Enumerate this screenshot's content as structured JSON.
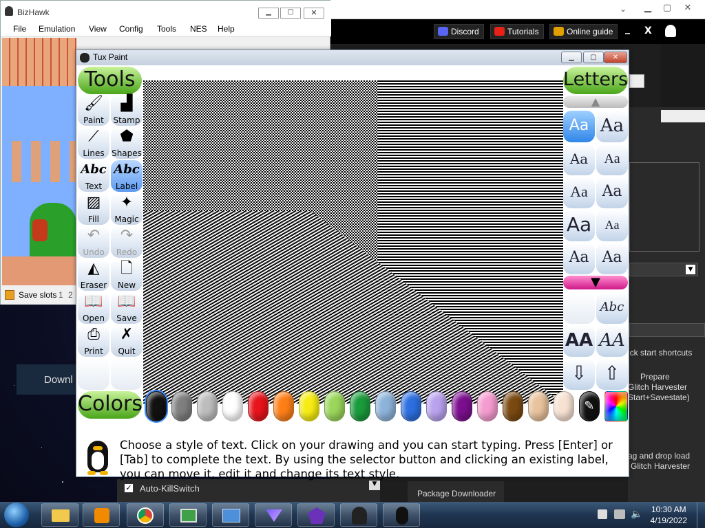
{
  "bizhawk": {
    "title": "BizHawk",
    "menu": [
      "File",
      "Emulation",
      "View",
      "Config",
      "Tools",
      "NES",
      "Help"
    ],
    "status_label": "Save slots",
    "slot_1": "1",
    "slot_2": "2"
  },
  "background_app": {
    "nav": {
      "discord": "Discord",
      "tutorials": "Tutorials",
      "online_guide": "Online guide",
      "minimize": "_",
      "close": "X"
    },
    "download_text": "Downl",
    "shortcuts_text": "ick start shortcuts",
    "prepare_text": "Prepare",
    "glitch_harvester_1": "Glitch Harvester",
    "savestate_text": "Start+Savestate)",
    "drag_drop_text": "ag and drop load",
    "glitch_harvester_2": "Glitch Harvester",
    "auto_killswitch": "Auto-KillSwitch",
    "package_downloader": "Package Downloader"
  },
  "tuxpaint": {
    "title": "Tux Paint",
    "tools_header": "Tools",
    "letters_header": "Letters",
    "colors_header": "Colors",
    "tools": [
      {
        "label": "Paint",
        "icon": "paintbrush-icon",
        "glyph": "🖌"
      },
      {
        "label": "Stamp",
        "icon": "stamp-icon",
        "glyph": "▟"
      },
      {
        "label": "Lines",
        "icon": "lines-icon",
        "glyph": "⟋"
      },
      {
        "label": "Shapes",
        "icon": "pentagon-icon",
        "glyph": "⬟"
      },
      {
        "label": "Text",
        "icon": "text-icon",
        "glyph": "Abc"
      },
      {
        "label": "Label",
        "icon": "label-icon",
        "glyph": "Abc"
      },
      {
        "label": "Fill",
        "icon": "bucket-icon",
        "glyph": "▨"
      },
      {
        "label": "Magic",
        "icon": "magic-wand-icon",
        "glyph": "✦"
      },
      {
        "label": "Undo",
        "icon": "undo-icon",
        "glyph": "↶"
      },
      {
        "label": "Redo",
        "icon": "redo-icon",
        "glyph": "↷"
      },
      {
        "label": "Eraser",
        "icon": "eraser-icon",
        "glyph": "◭"
      },
      {
        "label": "New",
        "icon": "new-page-icon",
        "glyph": "🗋"
      },
      {
        "label": "Open",
        "icon": "open-book-icon",
        "glyph": "📖"
      },
      {
        "label": "Save",
        "icon": "save-book-icon",
        "glyph": "📖"
      },
      {
        "label": "Print",
        "icon": "printer-icon",
        "glyph": "⎙"
      },
      {
        "label": "Quit",
        "icon": "quit-icon",
        "glyph": "✗"
      }
    ],
    "font_samples": [
      "Aa",
      "Aa",
      "Aa",
      "Aa",
      "Aa",
      "Aa",
      "Aa",
      "Aa",
      "Aa",
      "Aa"
    ],
    "label_tool_glyph": "Abc",
    "size_small": "AA",
    "size_large": "AA",
    "colors": [
      "#111111",
      "#7f7f7f",
      "#bdbdbd",
      "#ffffff",
      "#e8141b",
      "#ff7f17",
      "#f6ec13",
      "#9ad65a",
      "#1a9b3c",
      "#8db3da",
      "#2d6fe0",
      "#b9a2ee",
      "#7c0f8f",
      "#f59bd0",
      "#7b4a12",
      "#e8c29c",
      "#f7e2d2"
    ],
    "tip": "Choose a style of text. Click on your drawing and you can start typing. Press [Enter] or [Tab] to complete the text. By using the selector button and clicking an existing label, you can move it, edit it and change its text style."
  },
  "taskbar": {
    "time": "10:30 AM",
    "date": "4/19/2022"
  }
}
